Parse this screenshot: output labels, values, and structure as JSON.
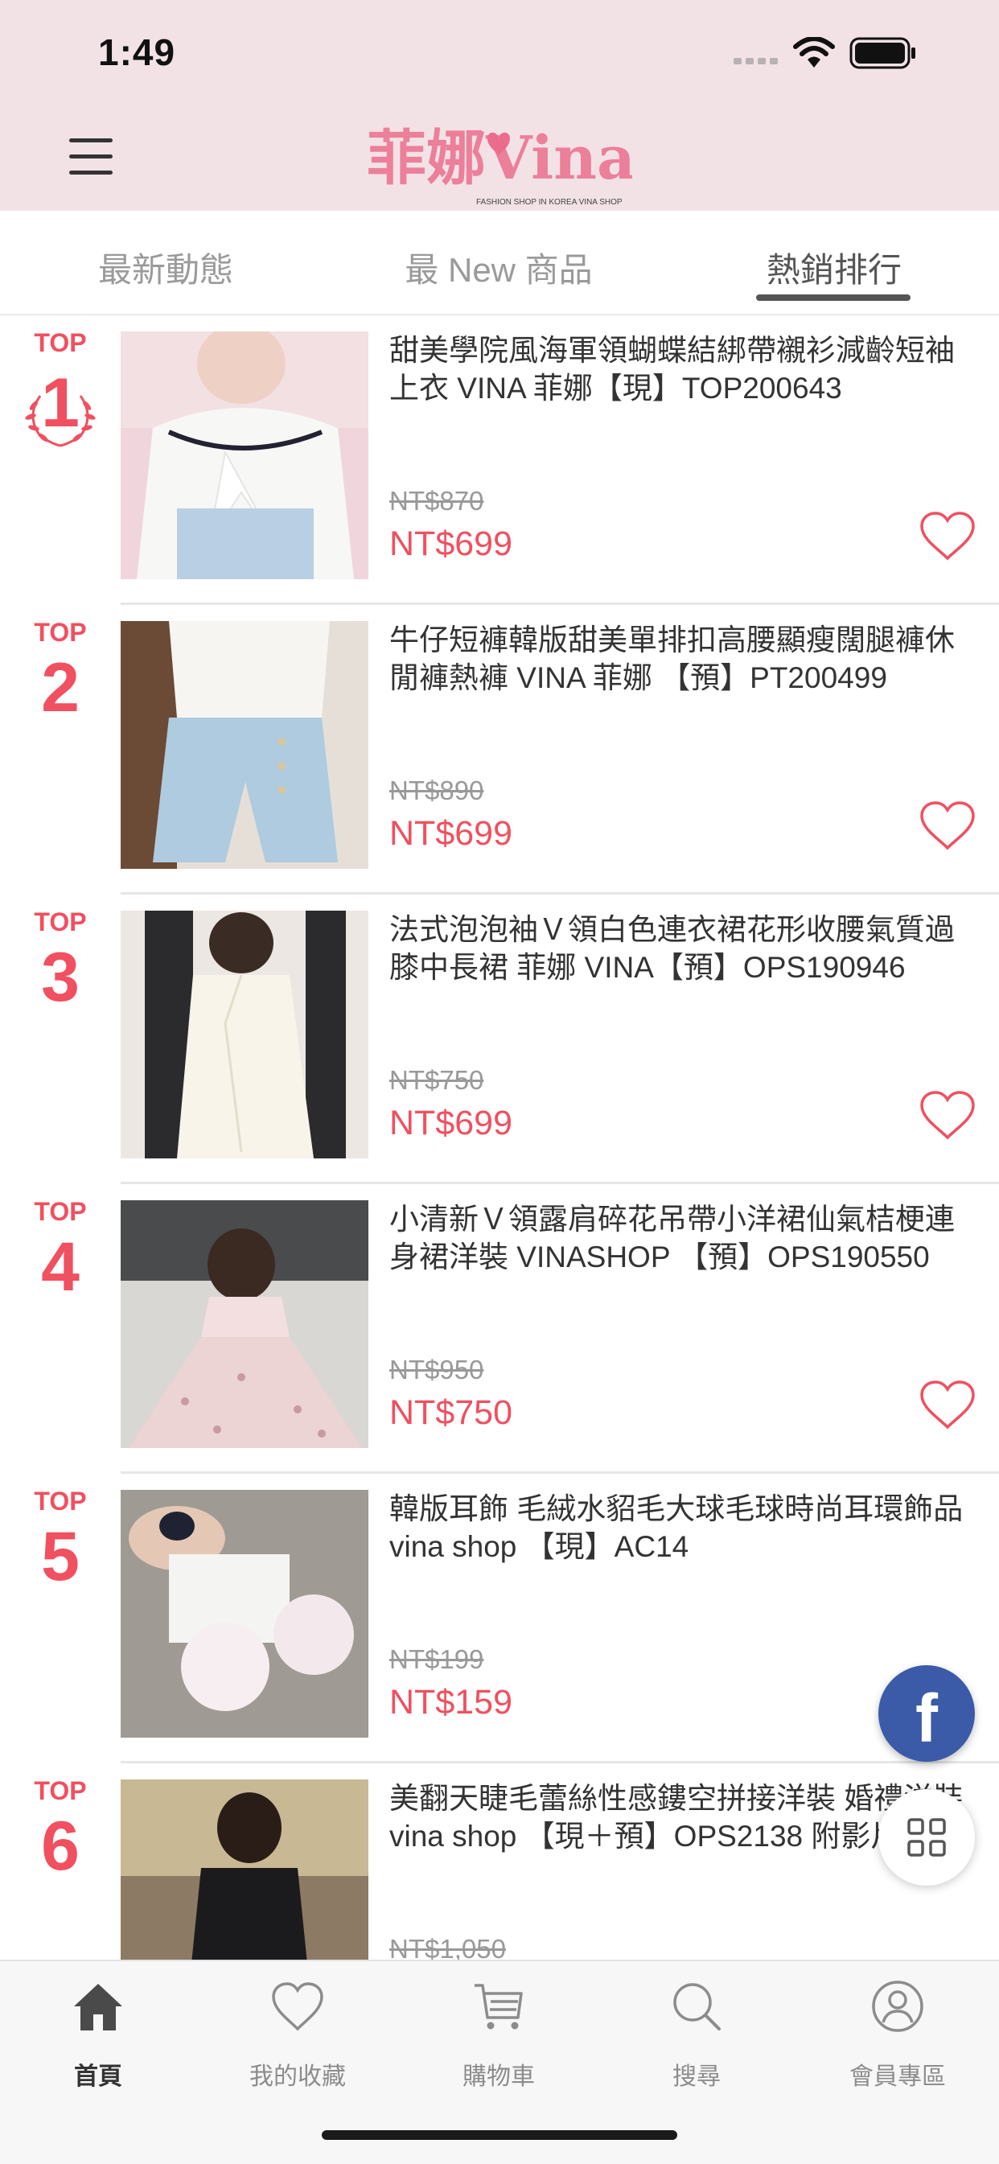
{
  "status_bar": {
    "time": "1:49"
  },
  "header": {
    "logo_text": "菲娜Vina",
    "logo_tagline": "FASHION SHOP IN KOREA  VINA SHOP"
  },
  "tabs": [
    {
      "label": "最新動態",
      "active": false
    },
    {
      "label": "最 New 商品",
      "active": false
    },
    {
      "label": "熱銷排行",
      "active": true
    }
  ],
  "rank_prefix": "TOP",
  "products": [
    {
      "rank": "1",
      "title": "甜美學院風海軍領蝴蝶結綁帶襯衫減齡短袖上衣 VINA 菲娜【現】TOP200643",
      "original_price": "NT$870",
      "price": "NT$699"
    },
    {
      "rank": "2",
      "title": "牛仔短褲韓版甜美單排扣高腰顯瘦闊腿褲休閒褲熱褲 VINA 菲娜 【預】PT200499",
      "original_price": "NT$890",
      "price": "NT$699"
    },
    {
      "rank": "3",
      "title": "法式泡泡袖Ｖ領白色連衣裙花形收腰氣質過膝中長裙 菲娜 VINA【預】OPS190946",
      "original_price": "NT$750",
      "price": "NT$699"
    },
    {
      "rank": "4",
      "title": "小清新Ｖ領露肩碎花吊帶小洋裙仙氣桔梗連身裙洋裝  VINASHOP 【預】OPS190550",
      "original_price": "NT$950",
      "price": "NT$750"
    },
    {
      "rank": "5",
      "title": "韓版耳飾 毛絨水貂毛大球毛球時尚耳環飾品 vina shop 【現】AC14",
      "original_price": "NT$199",
      "price": "NT$159"
    },
    {
      "rank": "6",
      "title": "美翻天睫毛蕾絲性感鏤空拼接洋裝 婚禮洋裝 vina shop 【現＋預】OPS2138 附影片",
      "original_price": "NT$1,050",
      "price": ""
    }
  ],
  "floating": {
    "facebook_glyph": "f"
  },
  "bottom_nav": [
    {
      "label": "首頁",
      "icon": "home-icon",
      "active": true
    },
    {
      "label": "我的收藏",
      "icon": "heart-icon",
      "active": false
    },
    {
      "label": "購物車",
      "icon": "cart-icon",
      "active": false
    },
    {
      "label": "搜尋",
      "icon": "search-icon",
      "active": false
    },
    {
      "label": "會員專區",
      "icon": "user-icon",
      "active": false
    }
  ],
  "colors": {
    "accent": "#f0505f",
    "header_bg": "#f2e2e6",
    "facebook": "#3b5ba8"
  }
}
